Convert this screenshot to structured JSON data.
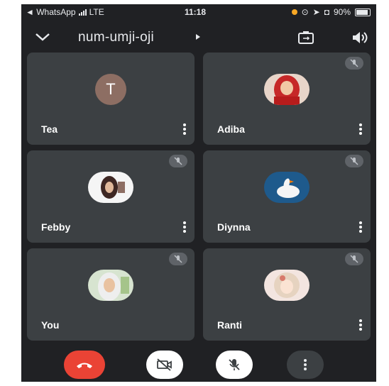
{
  "status_bar": {
    "app_back_label": "◄ WhatsApp",
    "network": "LTE",
    "time": "11:18",
    "battery": "90%"
  },
  "meeting": {
    "code": "num-umji-oji"
  },
  "participants": [
    {
      "name": "Tea",
      "initial": "T",
      "avatar_color": "#8d6e63",
      "muted": false
    },
    {
      "name": "Adiba",
      "muted": true
    },
    {
      "name": "Febby",
      "muted": true
    },
    {
      "name": "Diynna",
      "muted": true
    },
    {
      "name": "You",
      "muted": true
    },
    {
      "name": "Ranti",
      "muted": true
    }
  ],
  "colors": {
    "background": "#202124",
    "tile": "#3c4043",
    "end_call": "#ea4335",
    "control_light": "#ffffff",
    "control_dark": "#3c4043"
  },
  "controls": [
    "end-call-icon",
    "camera-off-icon",
    "mic-off-icon",
    "more-vert-icon"
  ]
}
